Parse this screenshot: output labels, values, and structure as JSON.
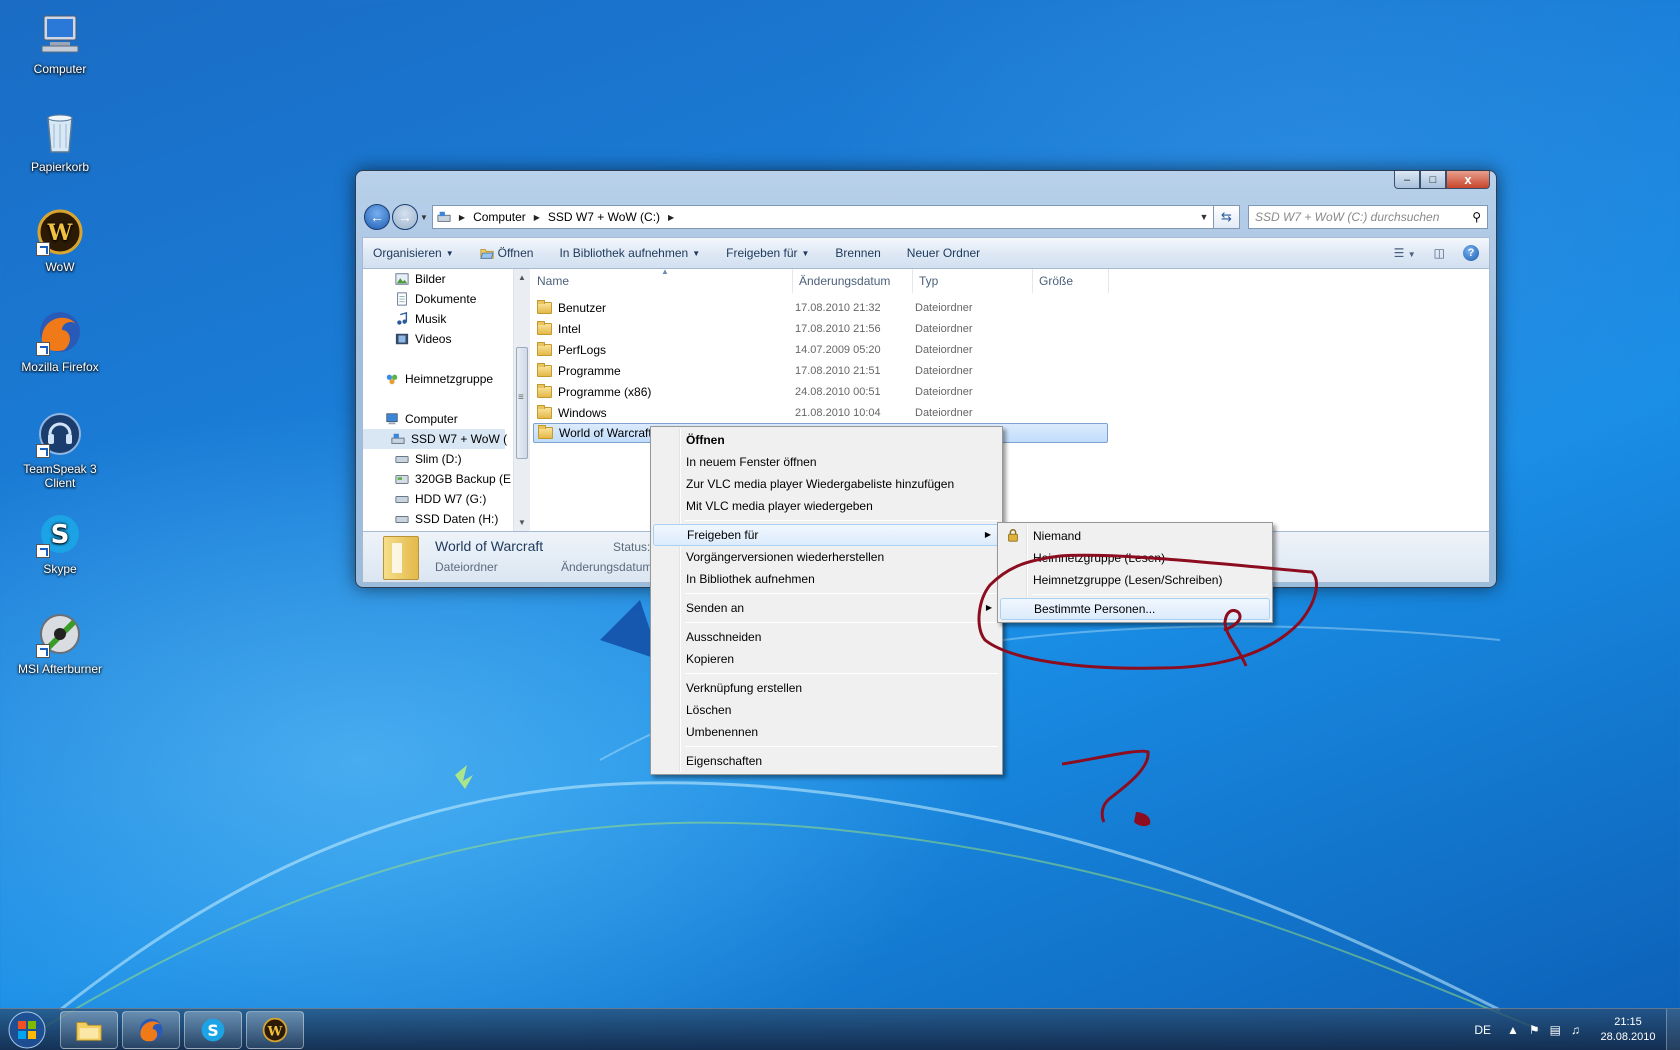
{
  "desktop_icons": [
    {
      "label": "Computer"
    },
    {
      "label": "Papierkorb"
    },
    {
      "label": "WoW"
    },
    {
      "label": "Mozilla Firefox"
    },
    {
      "label": "TeamSpeak 3 Client"
    },
    {
      "label": "Skype"
    },
    {
      "label": "MSI Afterburner"
    }
  ],
  "window": {
    "caption_buttons": {
      "minimize": "–",
      "maximize": "□",
      "close": "x"
    },
    "address": {
      "crumbs": [
        "Computer",
        "SSD W7 + WoW (C:)"
      ]
    },
    "search": {
      "placeholder": "SSD W7 + WoW (C:) durchsuchen"
    },
    "toolbar": {
      "organize": "Organisieren",
      "open": "Öffnen",
      "library": "In Bibliothek aufnehmen",
      "share": "Freigeben für",
      "burn": "Brennen",
      "new_folder": "Neuer Ordner"
    },
    "navpane": {
      "items": [
        "Bilder",
        "Dokumente",
        "Musik",
        "Videos",
        "Heimnetzgruppe",
        "Computer",
        "SSD W7 + WoW (",
        "Slim (D:)",
        "320GB Backup (E",
        "HDD W7 (G:)",
        "SSD Daten (H:)"
      ]
    },
    "columns": {
      "name": "Name",
      "date": "Änderungsdatum",
      "type": "Typ",
      "size": "Größe"
    },
    "files": [
      {
        "name": "Benutzer",
        "date": "17.08.2010 21:32",
        "type": "Dateiordner"
      },
      {
        "name": "Intel",
        "date": "17.08.2010 21:56",
        "type": "Dateiordner"
      },
      {
        "name": "PerfLogs",
        "date": "14.07.2009 05:20",
        "type": "Dateiordner"
      },
      {
        "name": "Programme",
        "date": "17.08.2010 21:51",
        "type": "Dateiordner"
      },
      {
        "name": "Programme (x86)",
        "date": "24.08.2010 00:51",
        "type": "Dateiordner"
      },
      {
        "name": "Windows",
        "date": "21.08.2010 10:04",
        "type": "Dateiordner"
      },
      {
        "name": "World of Warcraft",
        "date": "",
        "type": ""
      }
    ],
    "details": {
      "name": "World of Warcraft",
      "type": "Dateiordner",
      "status_label": "Status:",
      "modified_label": "Änderungsdatum:"
    }
  },
  "context_menu": {
    "items": [
      "Öffnen",
      "In neuem Fenster öffnen",
      "Zur VLC media player Wiedergabeliste hinzufügen",
      "Mit VLC media player wiedergeben",
      "Freigeben für",
      "Vorgängerversionen wiederherstellen",
      "In Bibliothek aufnehmen",
      "Senden an",
      "Ausschneiden",
      "Kopieren",
      "Verknüpfung erstellen",
      "Löschen",
      "Umbenennen",
      "Eigenschaften"
    ]
  },
  "submenu": {
    "items": [
      "Niemand",
      "Heimnetzgruppe (Lesen)",
      "Heimnetzgruppe (Lesen/Schreiben)",
      "Bestimmte Personen..."
    ]
  },
  "annotation": {
    "color": "#8b0d1f",
    "mark": "?"
  },
  "taskbar": {
    "language": "DE",
    "time": "21:15",
    "date": "28.08.2010"
  },
  "colors": {
    "accent": "#1a6cc4",
    "selection": "#c1dcfc"
  }
}
